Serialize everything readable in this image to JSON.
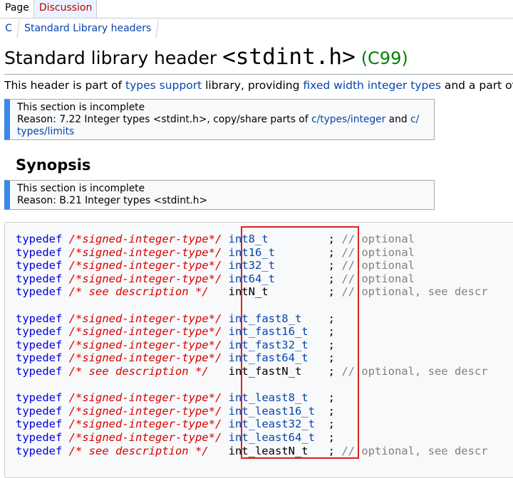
{
  "tabs": [
    {
      "label": "Page"
    },
    {
      "label": "Discussion"
    }
  ],
  "breadcrumbs": [
    "C",
    "Standard Library headers"
  ],
  "title": {
    "prefix": "Standard library header",
    "header": "<stdint.h>",
    "standard": "(C99)"
  },
  "intro": {
    "t1": "This header is part of ",
    "l1": "types support",
    "t2": " library, providing ",
    "l2": "fixed width integer types",
    "t3": " and a part of"
  },
  "notice1": {
    "line1": "This section is incomplete",
    "line2_text": "Reason: 7.22 Integer types <stdint.h>, copy/share parts of ",
    "link1": "c/types/integer",
    "and": " and ",
    "link2a": "c/",
    "link2b": "types/limits"
  },
  "synopsis_heading": "Synopsis",
  "notice2": {
    "line1": "This section is incomplete",
    "line2": "Reason: B.21 Integer types <stdint.h>"
  },
  "code": {
    "keyword": "typedef",
    "groups": [
      [
        {
          "comment": "/*signed-integer-type*/",
          "type": "int8_t",
          "link": true,
          "semi": ";",
          "note": "// optional"
        },
        {
          "comment": "/*signed-integer-type*/",
          "type": "int16_t",
          "link": true,
          "semi": ";",
          "note": "// optional"
        },
        {
          "comment": "/*signed-integer-type*/",
          "type": "int32_t",
          "link": true,
          "semi": ";",
          "note": "// optional"
        },
        {
          "comment": "/*signed-integer-type*/",
          "type": "int64_t",
          "link": true,
          "semi": ";",
          "note": "// optional"
        },
        {
          "comment": "/* see description */",
          "type": "intN_t",
          "link": false,
          "semi": ";",
          "note": "// optional, see descr"
        }
      ],
      [
        {
          "comment": "/*signed-integer-type*/",
          "type": "int_fast8_t",
          "link": true,
          "semi": ";",
          "note": ""
        },
        {
          "comment": "/*signed-integer-type*/",
          "type": "int_fast16_t",
          "link": true,
          "semi": ";",
          "note": ""
        },
        {
          "comment": "/*signed-integer-type*/",
          "type": "int_fast32_t",
          "link": true,
          "semi": ";",
          "note": ""
        },
        {
          "comment": "/*signed-integer-type*/",
          "type": "int_fast64_t",
          "link": true,
          "semi": ";",
          "note": ""
        },
        {
          "comment": "/* see description */",
          "type": "int_fastN_t",
          "link": false,
          "semi": ";",
          "note": "// optional, see descr"
        }
      ],
      [
        {
          "comment": "/*signed-integer-type*/",
          "type": "int_least8_t",
          "link": true,
          "semi": ";",
          "note": ""
        },
        {
          "comment": "/*signed-integer-type*/",
          "type": "int_least16_t",
          "link": true,
          "semi": ";",
          "note": ""
        },
        {
          "comment": "/*signed-integer-type*/",
          "type": "int_least32_t",
          "link": true,
          "semi": ";",
          "note": ""
        },
        {
          "comment": "/*signed-integer-type*/",
          "type": "int_least64_t",
          "link": true,
          "semi": ";",
          "note": ""
        },
        {
          "comment": "/* see description */",
          "type": "int_leastN_t",
          "link": false,
          "semi": ";",
          "note": "// optional, see descr"
        }
      ]
    ]
  },
  "colors": {
    "link": "#0645ad",
    "keyword": "#0000dd",
    "comment": "#d90000",
    "standard": "#008000",
    "highlight": "#e02020"
  }
}
